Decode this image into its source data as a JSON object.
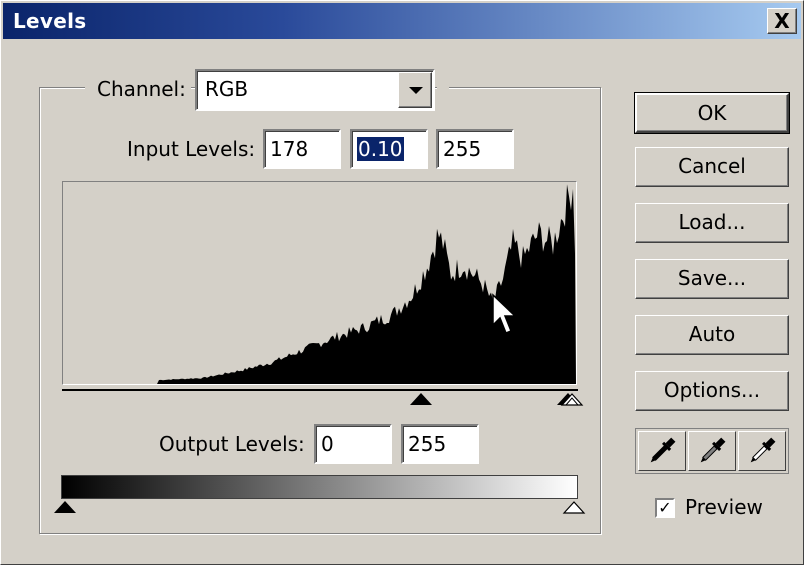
{
  "window": {
    "title": "Levels",
    "close_symbol": "X"
  },
  "channel": {
    "label": "Channel:",
    "value": "RGB"
  },
  "input_levels": {
    "label": "Input Levels:",
    "black": "178",
    "gamma": "0.10",
    "white": "255"
  },
  "output_levels": {
    "label": "Output Levels:",
    "black": "0",
    "white": "255"
  },
  "buttons": {
    "ok": "OK",
    "cancel": "Cancel",
    "load": "Load...",
    "save": "Save...",
    "auto": "Auto",
    "options": "Options..."
  },
  "eyedroppers": [
    "black-point-eyedropper-icon",
    "gray-point-eyedropper-icon",
    "white-point-eyedropper-icon"
  ],
  "preview": {
    "label": "Preview",
    "checked": true,
    "check_glyph": "✓"
  },
  "colors": {
    "title_start": "#0a246a",
    "title_end": "#a6caf0",
    "face": "#d4d0c8",
    "selection": "#0a246a"
  }
}
